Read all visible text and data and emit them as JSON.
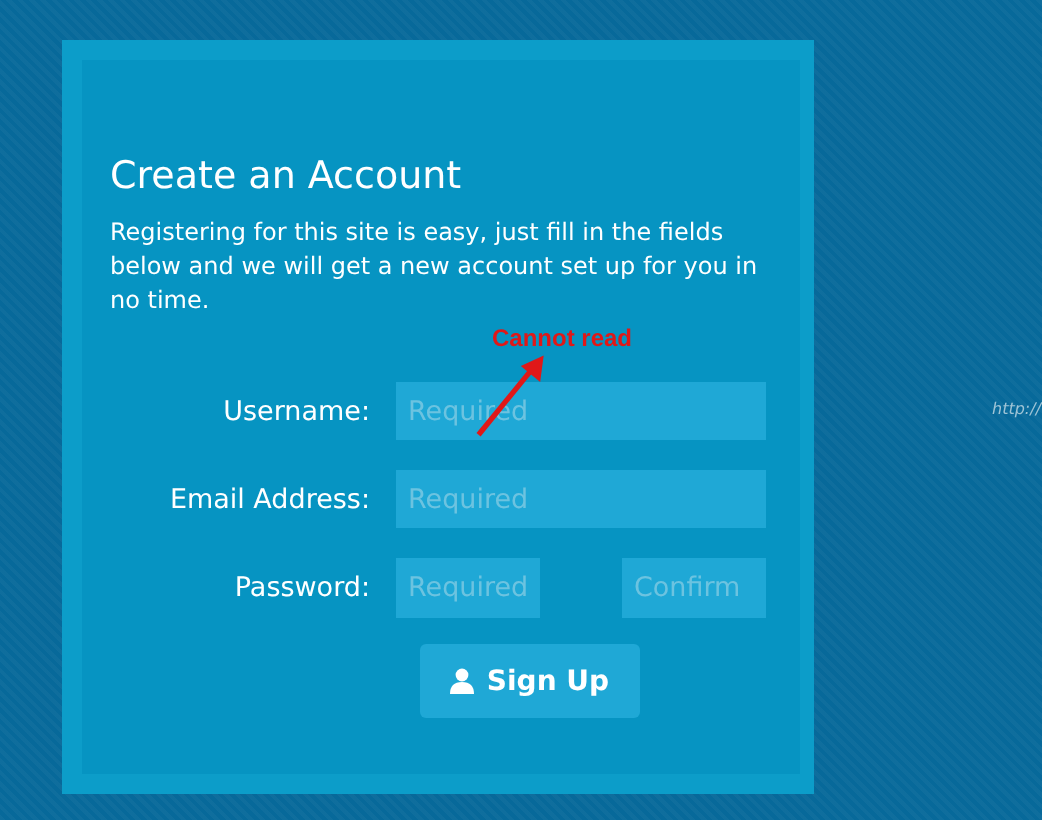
{
  "form": {
    "title": "Create an Account",
    "intro": "Registering for this site is easy, just fill in the fields below and we will get a new account set up for you in no time.",
    "fields": [
      {
        "label": "Username:",
        "inputs": [
          {
            "placeholder": "Required"
          }
        ]
      },
      {
        "label": "Email Address:",
        "inputs": [
          {
            "placeholder": "Required"
          }
        ]
      },
      {
        "label": "Password:",
        "inputs": [
          {
            "placeholder": "Required"
          },
          {
            "placeholder": "Confirm"
          }
        ]
      }
    ],
    "submit": "Sign Up"
  },
  "annotation": {
    "text": "Cannot read"
  },
  "side_link": "http://"
}
